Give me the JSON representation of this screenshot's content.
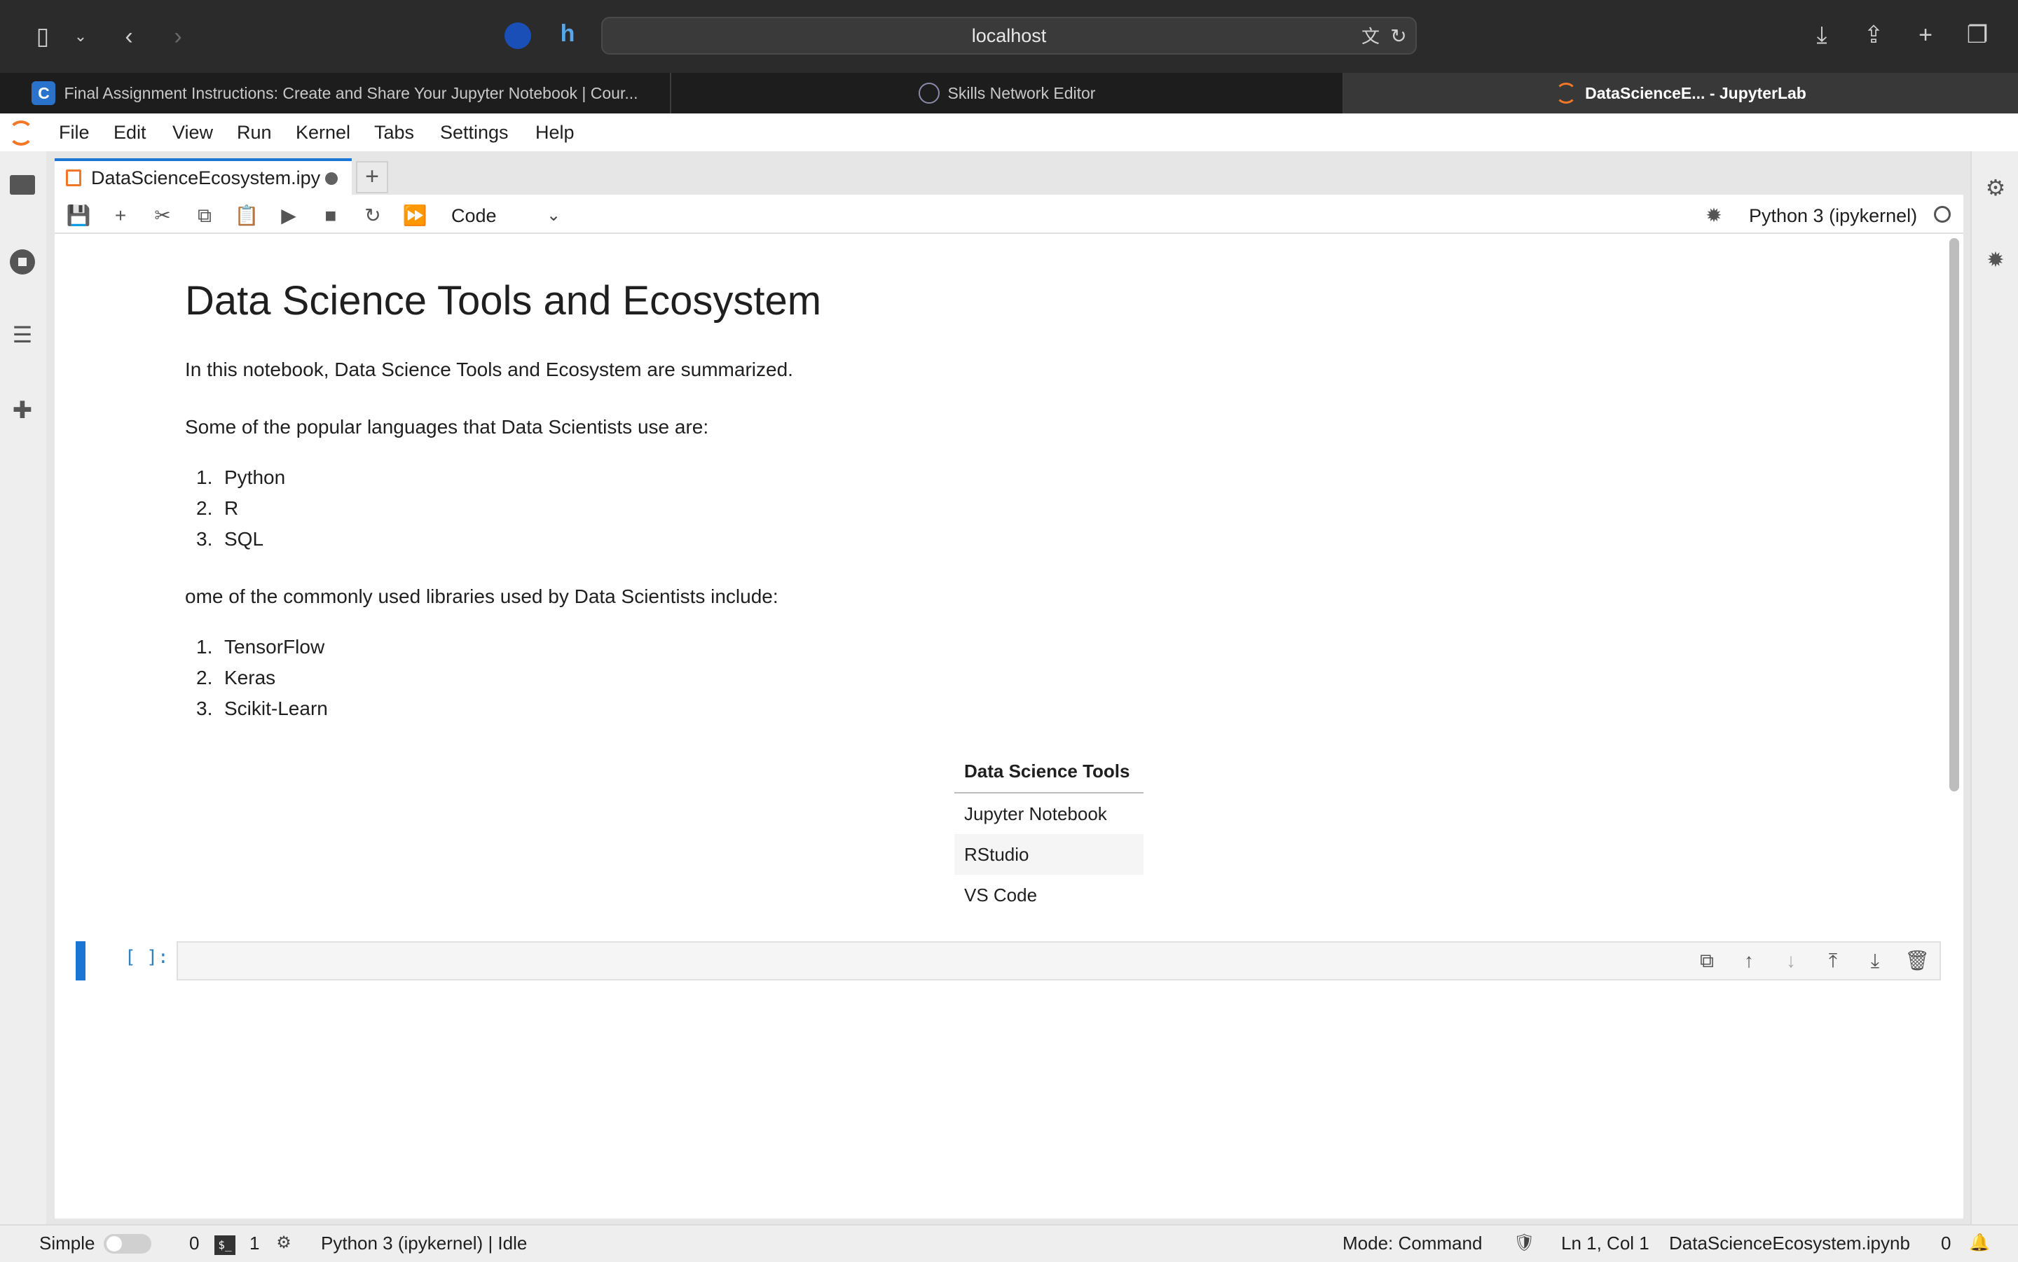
{
  "browser": {
    "url": "localhost",
    "tabs": [
      {
        "label": "Final Assignment Instructions: Create and Share Your Jupyter Notebook | Cour...",
        "active": false
      },
      {
        "label": "Skills Network Editor",
        "active": false
      },
      {
        "label": "DataScienceE... - JupyterLab",
        "active": true
      }
    ]
  },
  "menu": [
    "File",
    "Edit",
    "View",
    "Run",
    "Kernel",
    "Tabs",
    "Settings",
    "Help"
  ],
  "notebook_tab": {
    "label": "DataScienceEcosystem.ipy",
    "unsaved": true
  },
  "toolbar": {
    "cell_type": "Code",
    "kernel": "Python 3 (ipykernel)"
  },
  "content": {
    "title": "Data Science Tools and Ecosystem",
    "intro": "In this notebook, Data Science Tools and Ecosystem are summarized.",
    "languages_heading": "Some of the popular languages that Data Scientists use are:",
    "languages": [
      "Python",
      "R",
      "SQL"
    ],
    "libraries_heading": "ome of the commonly used libraries used by Data Scientists include:",
    "libraries": [
      "TensorFlow",
      "Keras",
      "Scikit-Learn"
    ],
    "table": {
      "header": "Data Science Tools",
      "rows": [
        "Jupyter Notebook",
        "RStudio",
        "VS Code"
      ]
    }
  },
  "code_cell": {
    "prompt": "[ ]:",
    "value": ""
  },
  "statusbar": {
    "mode_label": "Simple",
    "terminals_count": "0",
    "kernels_count": "1",
    "kernel_status": "Python 3 (ipykernel) | Idle",
    "mode": "Mode: Command",
    "cursor": "Ln 1, Col 1",
    "filename": "DataScienceEcosystem.ipynb",
    "notifications": "0"
  },
  "colors": {
    "accent": "#1976d2",
    "jupyter_orange": "#f37726"
  }
}
